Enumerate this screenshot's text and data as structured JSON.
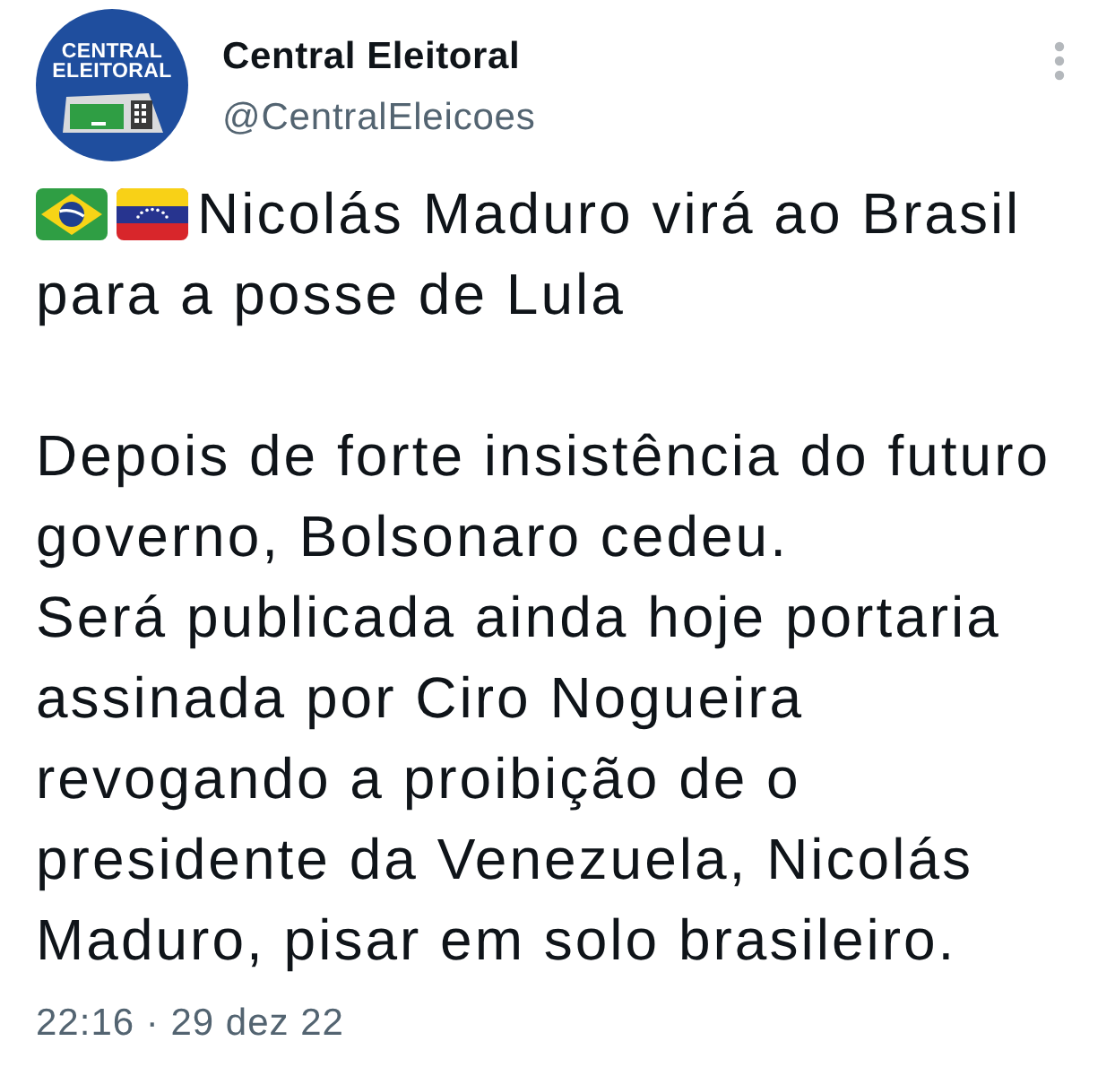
{
  "author": {
    "avatar": {
      "text": "CENTRAL\nELEITORAL"
    },
    "name": "Central Eleitoral",
    "handle": "@CentralEleicoes"
  },
  "tweet": {
    "flags": [
      {
        "kind": "brazil"
      },
      {
        "kind": "venezuela"
      }
    ],
    "headline": "Nicolás Maduro virá ao Brasil\npara a posse de Lula",
    "paragraphs": [
      "Depois de forte insistência do futuro\ngoverno, Bolsonaro cedeu.",
      "Será publicada ainda hoje portaria\nassinada por Ciro Nogueira\nrevogando a proibição de o\npresidente da Venezuela, Nicolás\nMaduro, pisar em solo brasileiro."
    ]
  },
  "timestamp": "22:16 · 29 dez 22"
}
